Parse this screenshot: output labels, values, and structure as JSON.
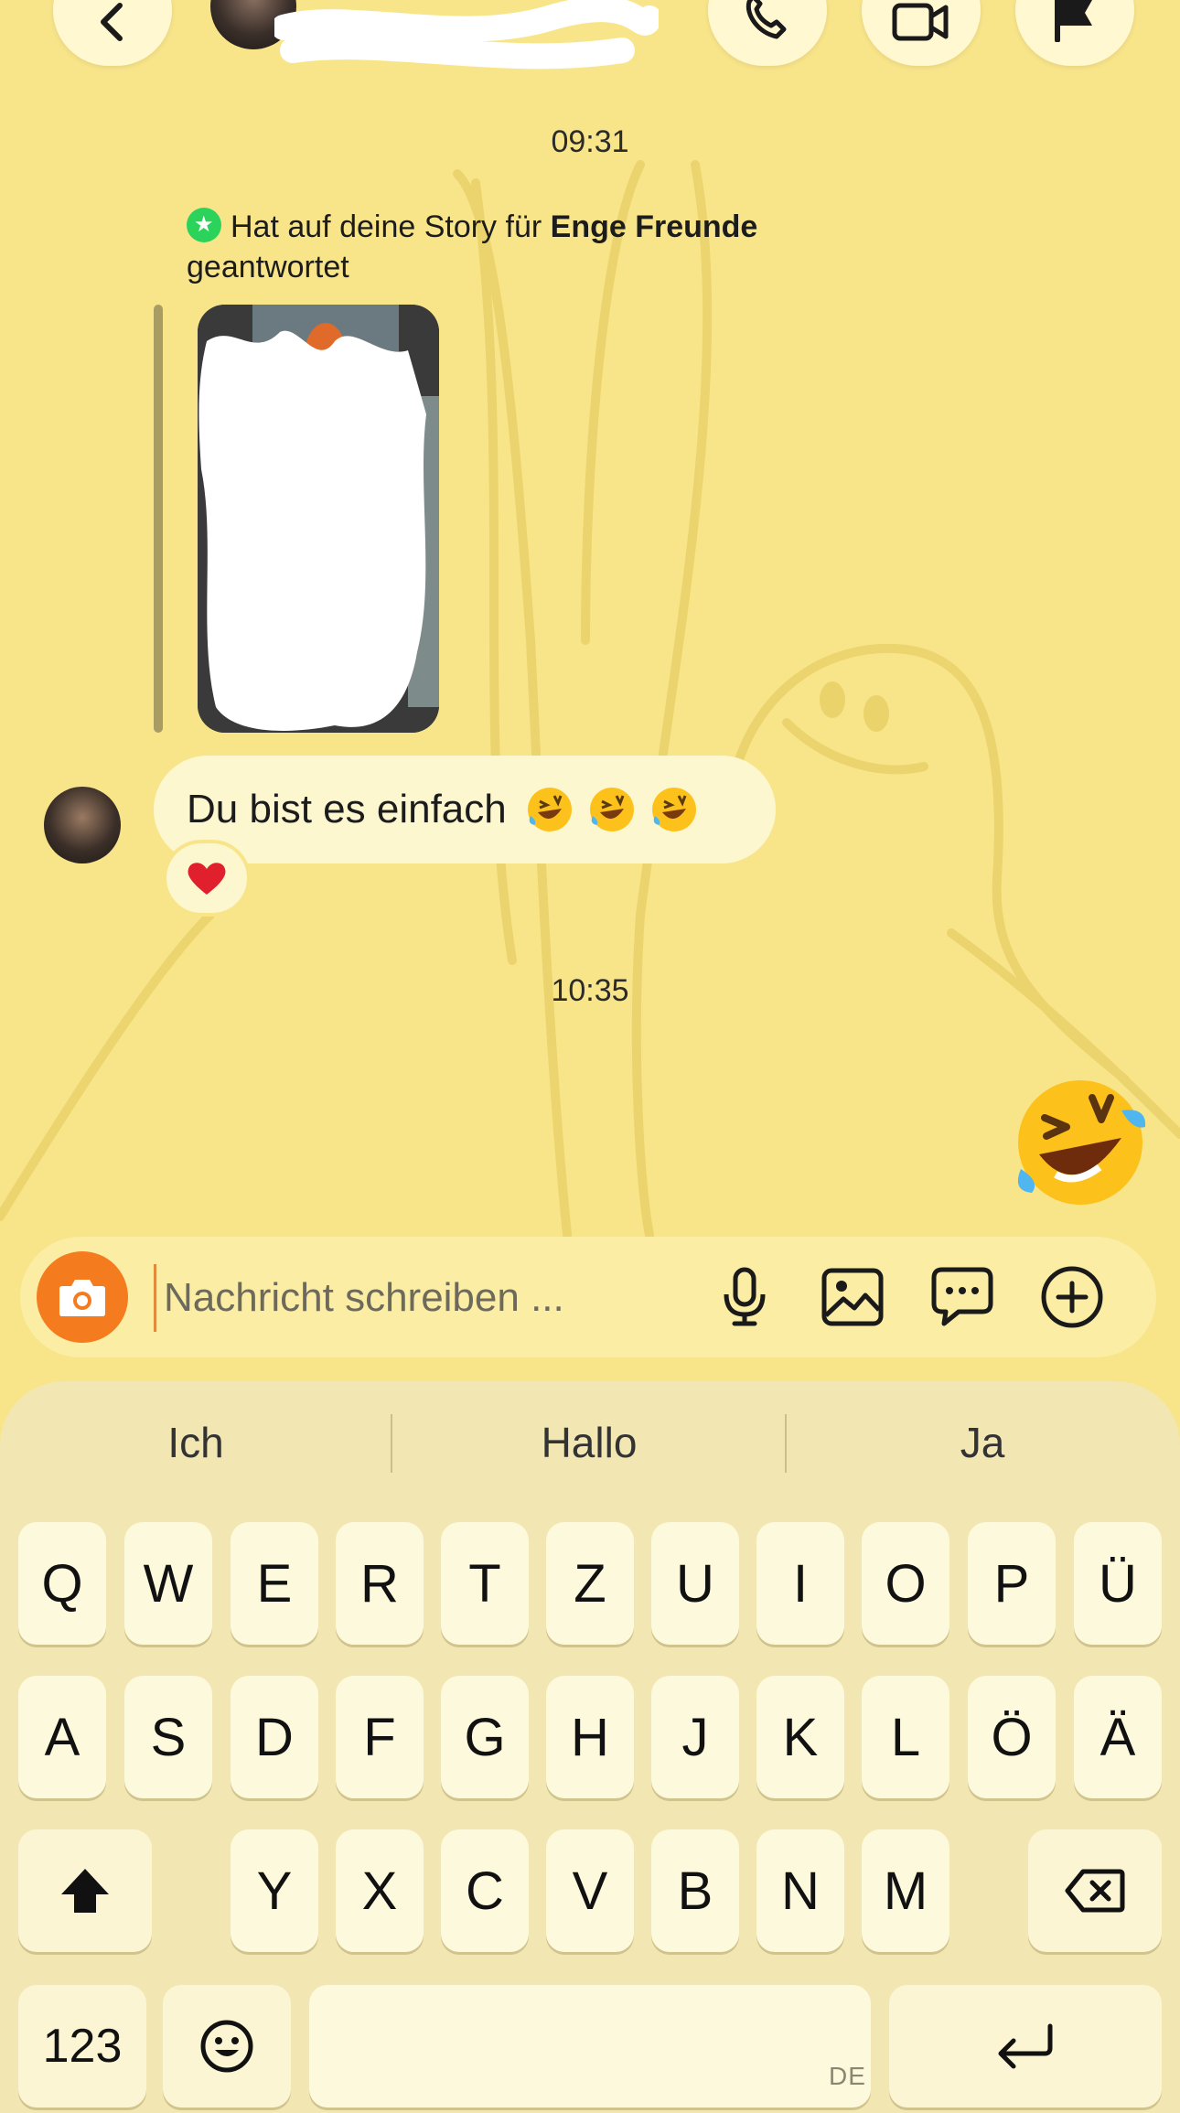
{
  "header": {
    "back_icon": "chevron-left-icon",
    "call_icon": "phone-icon",
    "video_icon": "video-icon",
    "flag_icon": "flag-icon"
  },
  "chat": {
    "timestamp_1": "09:31",
    "story_reply_prefix": "Hat auf deine Story für",
    "story_reply_bold": "Enge Freunde",
    "story_reply_suffix": "geantwortet",
    "message_text": "Du bist es einfach",
    "message_emojis": [
      "rofl-emoji",
      "rofl-emoji",
      "rofl-emoji"
    ],
    "reaction": "heart-emoji",
    "timestamp_2": "10:35",
    "sent_emoji": "rofl-emoji"
  },
  "composer": {
    "placeholder": "Nachricht schreiben ...",
    "icons": [
      "camera-icon",
      "microphone-icon",
      "image-icon",
      "chat-bubble-icon",
      "plus-circle-icon"
    ]
  },
  "keyboard": {
    "suggestions": [
      "Ich",
      "Hallo",
      "Ja"
    ],
    "row1": [
      "Q",
      "W",
      "E",
      "R",
      "T",
      "Z",
      "U",
      "I",
      "O",
      "P",
      "Ü"
    ],
    "row2": [
      "A",
      "S",
      "D",
      "F",
      "G",
      "H",
      "J",
      "K",
      "L",
      "Ö",
      "Ä"
    ],
    "row3": [
      "Y",
      "X",
      "C",
      "V",
      "B",
      "N",
      "M"
    ],
    "numbers_label": "123",
    "language": "DE"
  },
  "colors": {
    "background": "#f8e58a",
    "bubble": "#fdf7cf",
    "camera_button": "#f57b1f",
    "story_star": "#2bd35a"
  }
}
